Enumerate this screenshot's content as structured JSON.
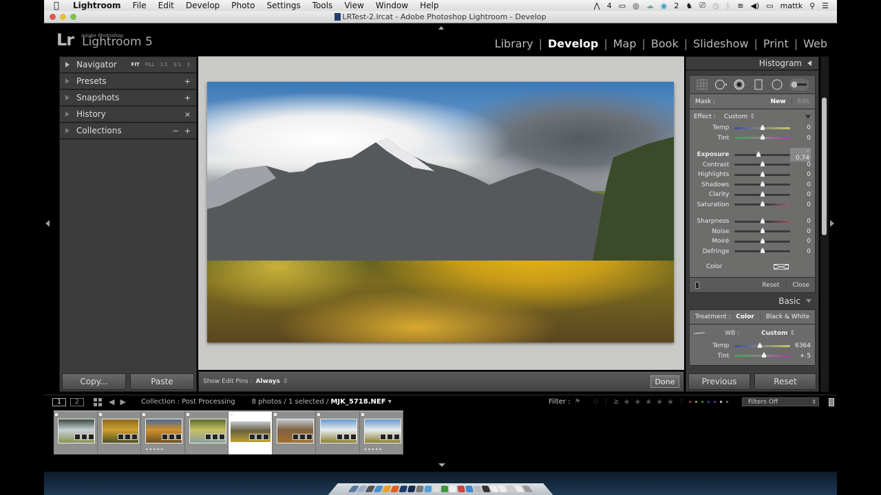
{
  "menubar": {
    "apple_icon": "apple-icon",
    "app": "Lightroom",
    "items": [
      "File",
      "Edit",
      "Develop",
      "Photo",
      "Settings",
      "Tools",
      "View",
      "Window",
      "Help"
    ],
    "status": {
      "adobe_count": "4",
      "cc_count": "2",
      "user": "mattk"
    }
  },
  "window": {
    "title": "LRTest-2.lrcat - Adobe Photoshop Lightroom - Develop"
  },
  "logo": {
    "mark": "Lr",
    "sub": "Adobe Photoshop",
    "name": "Lightroom 5"
  },
  "modules": [
    {
      "label": "Library",
      "active": false
    },
    {
      "label": "Develop",
      "active": true
    },
    {
      "label": "Map",
      "active": false
    },
    {
      "label": "Book",
      "active": false
    },
    {
      "label": "Slideshow",
      "active": false
    },
    {
      "label": "Print",
      "active": false
    },
    {
      "label": "Web",
      "active": false
    }
  ],
  "left_panel": {
    "navigator": {
      "label": "Navigator",
      "zoom": [
        "FIT",
        "FILL",
        "1:1",
        "3:1"
      ],
      "zoom_active": "FIT"
    },
    "sections": [
      {
        "label": "Presets",
        "action": "+"
      },
      {
        "label": "Snapshots",
        "action": "+"
      },
      {
        "label": "History",
        "action": "×"
      },
      {
        "label": "Collections",
        "action_minus": "−",
        "action": "+"
      }
    ],
    "copy_label": "Copy...",
    "paste_label": "Paste"
  },
  "center_toolbar": {
    "pins_label": "Show Edit Pins :",
    "pins_value": "Always",
    "done_label": "Done"
  },
  "right_panel": {
    "histogram_label": "Histogram",
    "tools": [
      "crop-overlay",
      "spot-removal",
      "red-eye",
      "graduated-filter",
      "radial-filter",
      "adjustment-brush"
    ],
    "mask": {
      "label": "Mask :",
      "new": "New",
      "edit": "Edit"
    },
    "effect": {
      "label": "Effect :",
      "value": "Custom"
    },
    "sliders_a": [
      {
        "label": "Temp",
        "value": "0",
        "pos": 0.5
      },
      {
        "label": "Tint",
        "value": "0",
        "pos": 0.5
      }
    ],
    "sliders_b": [
      {
        "label": "Exposure",
        "value": "– 0.74",
        "pos": 0.42,
        "active": true
      },
      {
        "label": "Contrast",
        "value": "0",
        "pos": 0.5
      },
      {
        "label": "Highlights",
        "value": "0",
        "pos": 0.5
      },
      {
        "label": "Shadows",
        "value": "0",
        "pos": 0.5
      },
      {
        "label": "Clarity",
        "value": "0",
        "pos": 0.5
      },
      {
        "label": "Saturation",
        "value": "0",
        "pos": 0.5
      }
    ],
    "sliders_c": [
      {
        "label": "Sharpness",
        "value": "0",
        "pos": 0.5
      },
      {
        "label": "Noise",
        "value": "0",
        "pos": 0.5
      },
      {
        "label": "Moiré",
        "value": "0",
        "pos": 0.5
      },
      {
        "label": "Defringe",
        "value": "0",
        "pos": 0.5
      }
    ],
    "color_label": "Color",
    "reset_label": "Reset",
    "close_label": "Close",
    "basic_label": "Basic",
    "treatment": {
      "label": "Treatment :",
      "color": "Color",
      "bw": "Black & White"
    },
    "wb": {
      "label": "WB :",
      "value": "Custom"
    },
    "basic_sliders": [
      {
        "label": "Temp",
        "value": "6364",
        "pos": 0.45
      },
      {
        "label": "Tint",
        "value": "+ 5",
        "pos": 0.52
      }
    ],
    "previous_label": "Previous",
    "reset_btn_label": "Reset"
  },
  "filmstrip_bar": {
    "page1": "1",
    "page2": "2",
    "collection": "Collection : Post Processing",
    "count": "8 photos / 1 selected /",
    "filename": "MJK_5718.NEF",
    "filter_label": "Filter :",
    "filter_op": "≥",
    "filter_select": "Filters Off"
  },
  "filmstrip": [
    {
      "name": "aspen-snow",
      "stars": 0,
      "selected": false,
      "colors": [
        "#3a4a3a",
        "#c8d0d8",
        "#8a9050"
      ]
    },
    {
      "name": "aspen-trunks",
      "stars": 0,
      "selected": false,
      "colors": [
        "#8a6a20",
        "#d0a030",
        "#4a5020"
      ]
    },
    {
      "name": "aspen-canopy",
      "stars": 5,
      "selected": false,
      "colors": [
        "#4a6a90",
        "#d09030",
        "#6a5020"
      ]
    },
    {
      "name": "aspen-light",
      "stars": 0,
      "selected": false,
      "colors": [
        "#5a6a30",
        "#c8c060",
        "#8aa0a0"
      ]
    },
    {
      "name": "mountain-valley",
      "stars": 0,
      "selected": true,
      "colors": [
        "#c0c8d0",
        "#6a6040",
        "#c0a030"
      ]
    },
    {
      "name": "mountain-range",
      "stars": 0,
      "selected": false,
      "colors": [
        "#c0c8d0",
        "#806040",
        "#a07030"
      ]
    },
    {
      "name": "snow-peaks",
      "stars": 0,
      "selected": false,
      "colors": [
        "#6a98c8",
        "#e8ecf0",
        "#8a8030"
      ]
    },
    {
      "name": "snow-peaks-2",
      "stars": 5,
      "selected": false,
      "colors": [
        "#6a98c8",
        "#e8ecf0",
        "#8a8030"
      ]
    }
  ],
  "colors": {
    "accent": "#ffffff",
    "panel": "#3c3c3c",
    "adjust_bg": "#6d6e6c",
    "center_bg": "#c9cac7"
  }
}
